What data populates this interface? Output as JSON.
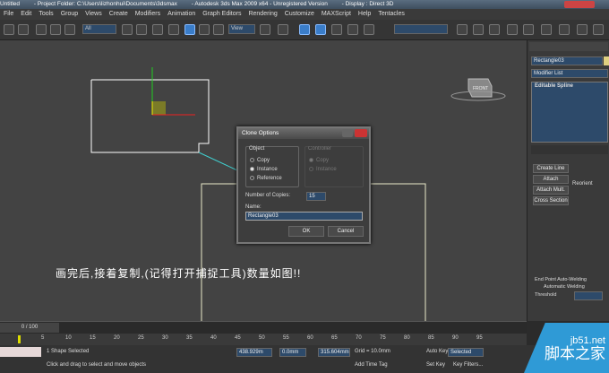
{
  "title": {
    "doc": "Untitled",
    "project": "- Project Folder: C:\\Users\\lizhonhui\\Documents\\3dsmax",
    "app": "- Autodesk 3ds Max  2009 x64  - Unregistered Version",
    "display": "- Display : Direct 3D"
  },
  "menu": [
    "File",
    "Edit",
    "Tools",
    "Group",
    "Views",
    "Create",
    "Modifiers",
    "Animation",
    "Graph Editors",
    "Rendering",
    "Customize",
    "MAXScript",
    "Help",
    "Tentacles"
  ],
  "toolbar": {
    "filter": "All",
    "refcoord": "View"
  },
  "viewport": {
    "viewcube": "FRONT",
    "caption": "画完后,接着复制,(记得打开捕捉工具)数量如图!!"
  },
  "dialog": {
    "title": "Clone Options",
    "object_label": "Object",
    "options": [
      "Copy",
      "Instance",
      "Reference"
    ],
    "selected": "Instance",
    "controller_label": "Controller",
    "controller_options": [
      "Copy",
      "Instance"
    ],
    "copies_label": "Number of Copies:",
    "copies": "15",
    "name_label": "Name:",
    "name": "Rectangle03",
    "ok": "OK",
    "cancel": "Cancel"
  },
  "panel": {
    "object_name": "Rectangle03",
    "modifier_list": "Modifier List",
    "stack_item": "Editable Spline",
    "buttons": {
      "create_line": "Create Line",
      "attach": "Attach",
      "attach_mult": "Attach Mult.",
      "reorient": "Reorient",
      "cross_section": "Cross Section",
      "end_point": "End Point Auto-Welding",
      "auto_weld": "Automatic Welding",
      "threshold": "Threshold"
    }
  },
  "timeline": {
    "frame": "0 / 100",
    "ticks": [
      "5",
      "10",
      "15",
      "20",
      "25",
      "30",
      "35",
      "40",
      "45",
      "50",
      "55",
      "60",
      "65",
      "70",
      "75",
      "80",
      "85",
      "90",
      "95"
    ]
  },
  "status": {
    "selection": "1 Shape Selected",
    "prompt": "Click and drag to select and move objects",
    "x": "438.929m",
    "y": "0.0mm",
    "z": "315.604mm",
    "grid": "Grid = 10.0mm",
    "autokey": "Auto Key",
    "selected": "Selected",
    "setkey": "Set Key",
    "keyfilters": "Key Filters...",
    "addtimetag": "Add Time Tag"
  },
  "watermark": {
    "site": "jb51.net",
    "name": "脚本之家"
  }
}
